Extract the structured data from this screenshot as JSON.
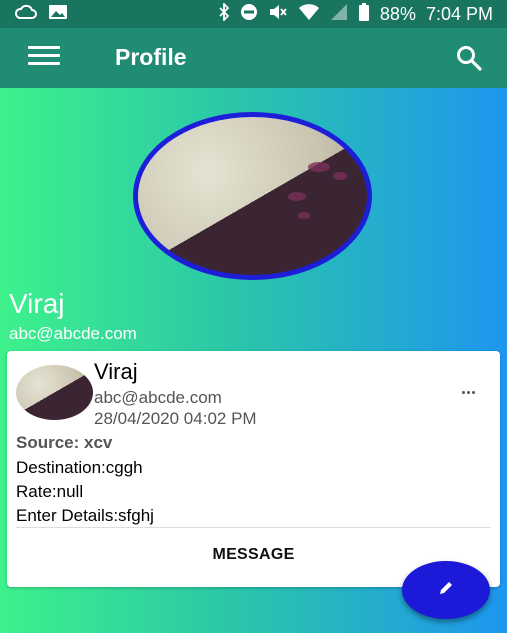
{
  "status_bar": {
    "battery": "88%",
    "time": "7:04 PM"
  },
  "app_bar": {
    "title": "Profile"
  },
  "profile": {
    "name": "Viraj",
    "email": "abc@abcde.com"
  },
  "card": {
    "name": "Viraj",
    "email": "abc@abcde.com",
    "datetime": "28/04/2020 04:02 PM",
    "source": "Source: xcv",
    "destination": "Destination:cggh",
    "rate": "Rate:null",
    "enter_details": "Enter Details:sfghj",
    "message_label": "MESSAGE"
  },
  "colors": {
    "status_bar": "#1a7560",
    "app_bar": "#1f8c73",
    "gradient_start": "#3ef18c",
    "gradient_end": "#1e96ef",
    "avatar_ring": "#1d1fd8",
    "fab": "#1c1ad8"
  },
  "icons": [
    "cloud-icon",
    "image-icon",
    "bluetooth-icon",
    "do-not-disturb-icon",
    "mute-icon",
    "wifi-icon",
    "signal-icon",
    "battery-icon",
    "menu-icon",
    "search-icon",
    "more-icon",
    "edit-icon"
  ]
}
